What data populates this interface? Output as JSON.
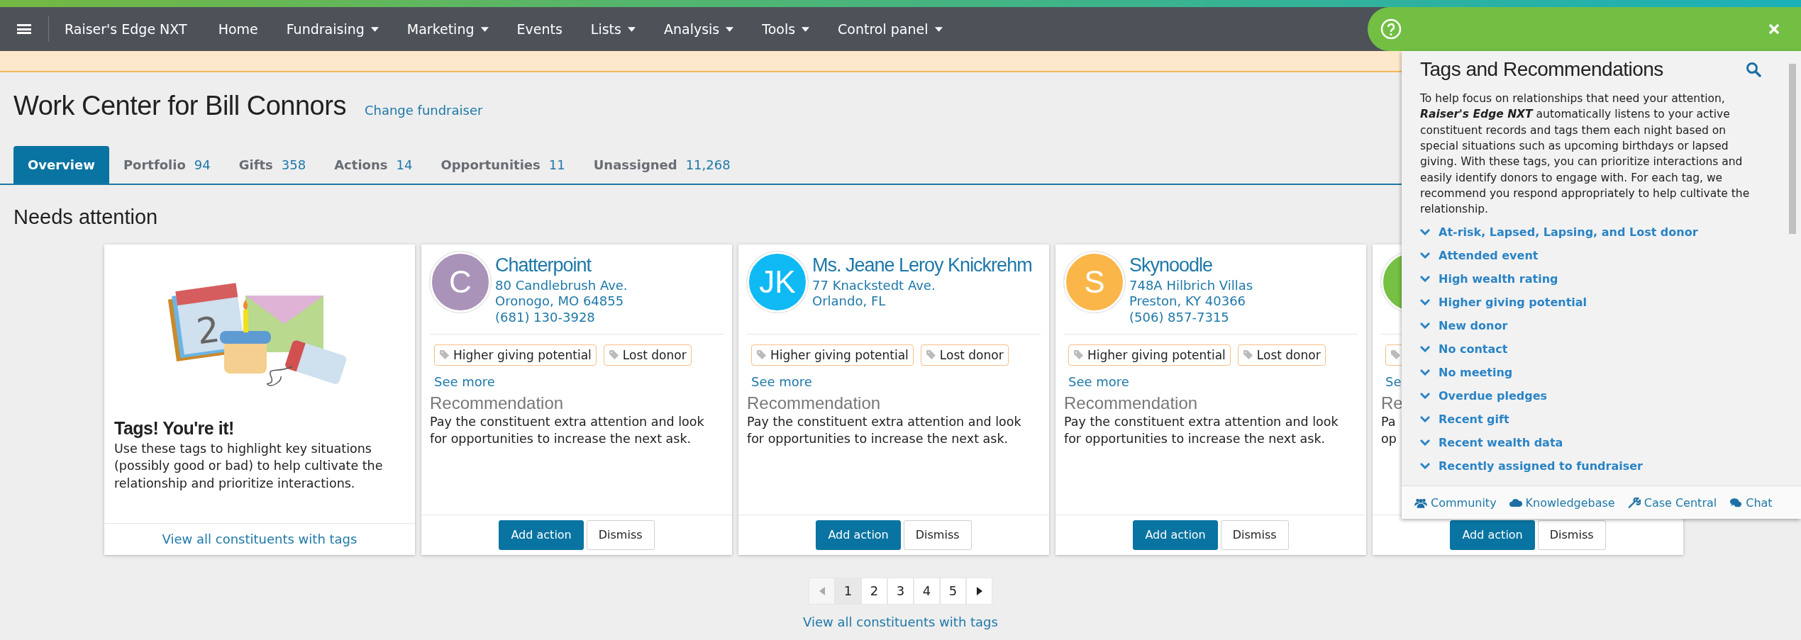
{
  "navbar": {
    "brand": "Raiser's Edge NXT",
    "items": [
      {
        "label": "Home",
        "dropdown": false
      },
      {
        "label": "Fundraising",
        "dropdown": true
      },
      {
        "label": "Marketing",
        "dropdown": true
      },
      {
        "label": "Events",
        "dropdown": false
      },
      {
        "label": "Lists",
        "dropdown": true
      },
      {
        "label": "Analysis",
        "dropdown": true
      },
      {
        "label": "Tools",
        "dropdown": true
      },
      {
        "label": "Control panel",
        "dropdown": true
      }
    ]
  },
  "header": {
    "title": "Work Center for Bill Connors",
    "link": "Change fundraiser"
  },
  "tabs": [
    {
      "label": "Overview",
      "selected": true
    },
    {
      "label": "Portfolio",
      "count": "94",
      "selected": false
    },
    {
      "label": "Gifts",
      "count": "358",
      "selected": false
    },
    {
      "label": "Actions",
      "count": "14",
      "selected": false
    },
    {
      "label": "Opportunities",
      "count": "11",
      "selected": false
    },
    {
      "label": "Unassigned",
      "count": "11,268",
      "selected": false
    }
  ],
  "section_title": "Needs attention",
  "cards": [
    {
      "kind": "intro",
      "calendar_day": "2",
      "heading": "Tags! You're it!",
      "text": "Use these tags to highlight key situations (possibly good or bad) to help cultivate the relationship and prioritize interactions.",
      "footer_link": "View all constituents with tags"
    },
    {
      "kind": "constituent",
      "initials": "C",
      "color": "#a993b9",
      "name": "Chatterpoint",
      "address": [
        "80 Candlebrush Ave.",
        "Oronogo, MO 64855",
        "(681) 130-3928"
      ],
      "tags": [
        "Higher giving potential",
        "Lost donor"
      ],
      "see_more": "See more",
      "recommendation_heading": "Recommendation",
      "recommendation": "Pay the constituent extra attention and look for opportunities to increase the next ask.",
      "buttons": [
        "Add action",
        "Dismiss"
      ]
    },
    {
      "kind": "constituent",
      "initials": "JK",
      "color": "#0fbaf4",
      "name": "Ms. Jeane Leroy Knickrehm",
      "address": [
        "77 Knackstedt Ave.",
        "Orlando, FL"
      ],
      "tags": [
        "Higher giving potential",
        "Lost donor"
      ],
      "see_more": "See more",
      "recommendation_heading": "Recommendation",
      "recommendation": "Pay the constituent extra attention and look for opportunities to increase the next ask.",
      "buttons": [
        "Add action",
        "Dismiss"
      ]
    },
    {
      "kind": "constituent",
      "initials": "S",
      "color": "#fbb64a",
      "name": "Skynoodle",
      "address": [
        "748A Hilbrich Villas",
        "Preston, KY 40366",
        "(506) 857-7315"
      ],
      "tags": [
        "Higher giving potential",
        "Lost donor"
      ],
      "see_more": "See more",
      "recommendation_heading": "Recommendation",
      "recommendation": "Pay the constituent extra attention and look for opportunities to increase the next ask.",
      "buttons": [
        "Add action",
        "Dismiss"
      ]
    },
    {
      "kind": "covered",
      "color": "#76c043",
      "see_more": "Se",
      "recommendation_heading": "Re",
      "recommendation_lines": [
        "Pa",
        "op"
      ],
      "buttons": [
        "Add action",
        "Dismiss"
      ]
    }
  ],
  "pagination": {
    "pages": [
      {
        "label": "1",
        "selected": true
      },
      {
        "label": "2",
        "selected": false
      },
      {
        "label": "3",
        "selected": false
      },
      {
        "label": "4",
        "selected": false
      },
      {
        "label": "5",
        "selected": false
      }
    ],
    "previous_disabled": true,
    "next_disabled": false
  },
  "bottom_link": "View all constituents with tags",
  "help_panel": {
    "title": "Tags and Recommendations",
    "intro": "To help focus on relationships that need your attention, **Raiser's Edge NXT** automatically listens to your active constituent records and tags them each night based on special situations such as upcoming birthdays or lapsed giving. With these tags, you can prioritize interactions and easily identify donors to engage with. For each tag, we recommend you respond appropriately to help cultivate the relationship.",
    "topics": [
      {
        "label": "At-risk, Lapsed, Lapsing, and Lost donor",
        "expanded": false
      },
      {
        "label": "Attended event",
        "expanded": false
      },
      {
        "label": "High wealth rating",
        "expanded": false
      },
      {
        "label": "Higher giving potential",
        "expanded": false
      },
      {
        "label": "New donor",
        "expanded": false
      },
      {
        "label": "No contact",
        "expanded": false
      },
      {
        "label": "No meeting",
        "expanded": false
      },
      {
        "label": "Overdue pledges",
        "expanded": false
      },
      {
        "label": "Recent gift",
        "expanded": false
      },
      {
        "label": "Recent wealth data",
        "expanded": false
      },
      {
        "label": "Recently assigned to fundraiser",
        "expanded": false
      }
    ],
    "footer": [
      {
        "kind": "community",
        "label": "Community"
      },
      {
        "kind": "knowledgebase",
        "label": "Knowledgebase"
      },
      {
        "kind": "case",
        "label": "Case Central"
      },
      {
        "kind": "chat",
        "label": "Chat"
      }
    ]
  }
}
